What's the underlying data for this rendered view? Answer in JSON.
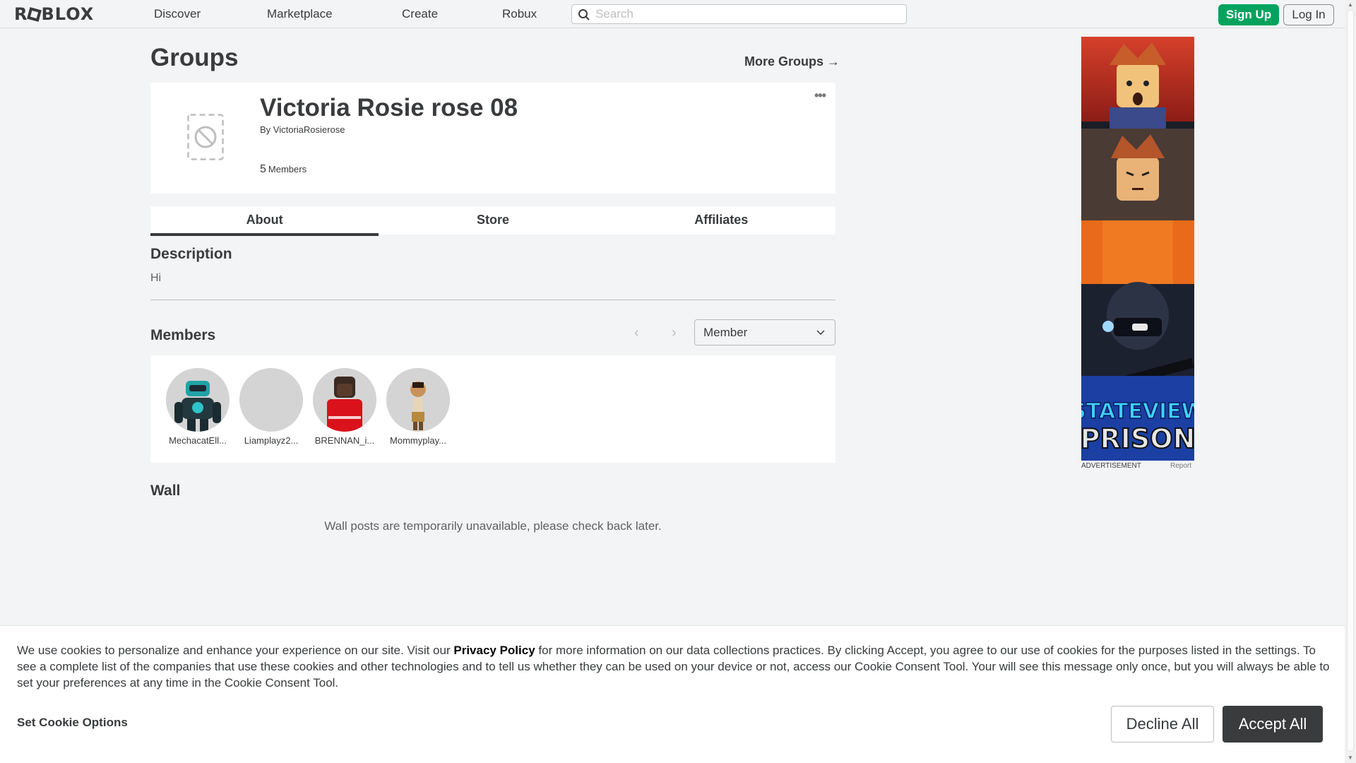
{
  "nav": {
    "logo": "ROBLOX",
    "links": [
      "Discover",
      "Marketplace",
      "Create",
      "Robux"
    ],
    "search_placeholder": "Search",
    "signup_label": "Sign Up",
    "login_label": "Log In"
  },
  "page": {
    "title": "Groups",
    "more_groups": "More Groups →"
  },
  "group": {
    "name": "Victoria Rosie rose 08",
    "by_label": "By",
    "owner": "VictoriaRosierose",
    "member_count": "5",
    "members_label": "Members",
    "more_icon": "more-dots-icon"
  },
  "tabs": [
    "About",
    "Store",
    "Affiliates"
  ],
  "description": {
    "title": "Description",
    "text": "Hi"
  },
  "members": {
    "title": "Members",
    "role_selected": "Member",
    "list": [
      {
        "name": "MechacatEll..."
      },
      {
        "name": "Liamplayz2..."
      },
      {
        "name": "BRENNAN_i..."
      },
      {
        "name": "Mommyplay..."
      }
    ]
  },
  "wall": {
    "title": "Wall",
    "message": "Wall posts are temporarily unavailable, please check back later."
  },
  "ad": {
    "label": "ADVERTISEMENT",
    "report": "Report",
    "banner_line1": "STATEVIEW",
    "banner_line2": "PRISON"
  },
  "cookie": {
    "text_before": "We use cookies to personalize and enhance your experience on our site. Visit our ",
    "privacy_link": "Privacy Policy",
    "text_after": " for more information on our data collections practices. By clicking Accept, you agree to our use of cookies for the purposes listed in the settings. To see a complete list of the companies that use these cookies and other technologies and to tell us whether they can be used on your device or not, access our Cookie Consent Tool. Your will see this message only once, but you will always be able to set your preferences at any time in the Cookie Consent Tool.",
    "set_options": "Set Cookie Options",
    "decline_label": "Decline All",
    "accept_label": "Accept All"
  },
  "colors": {
    "signup_green": "#00a35d",
    "accept_dark": "#393b3d",
    "page_bg": "#f2f4f5"
  }
}
